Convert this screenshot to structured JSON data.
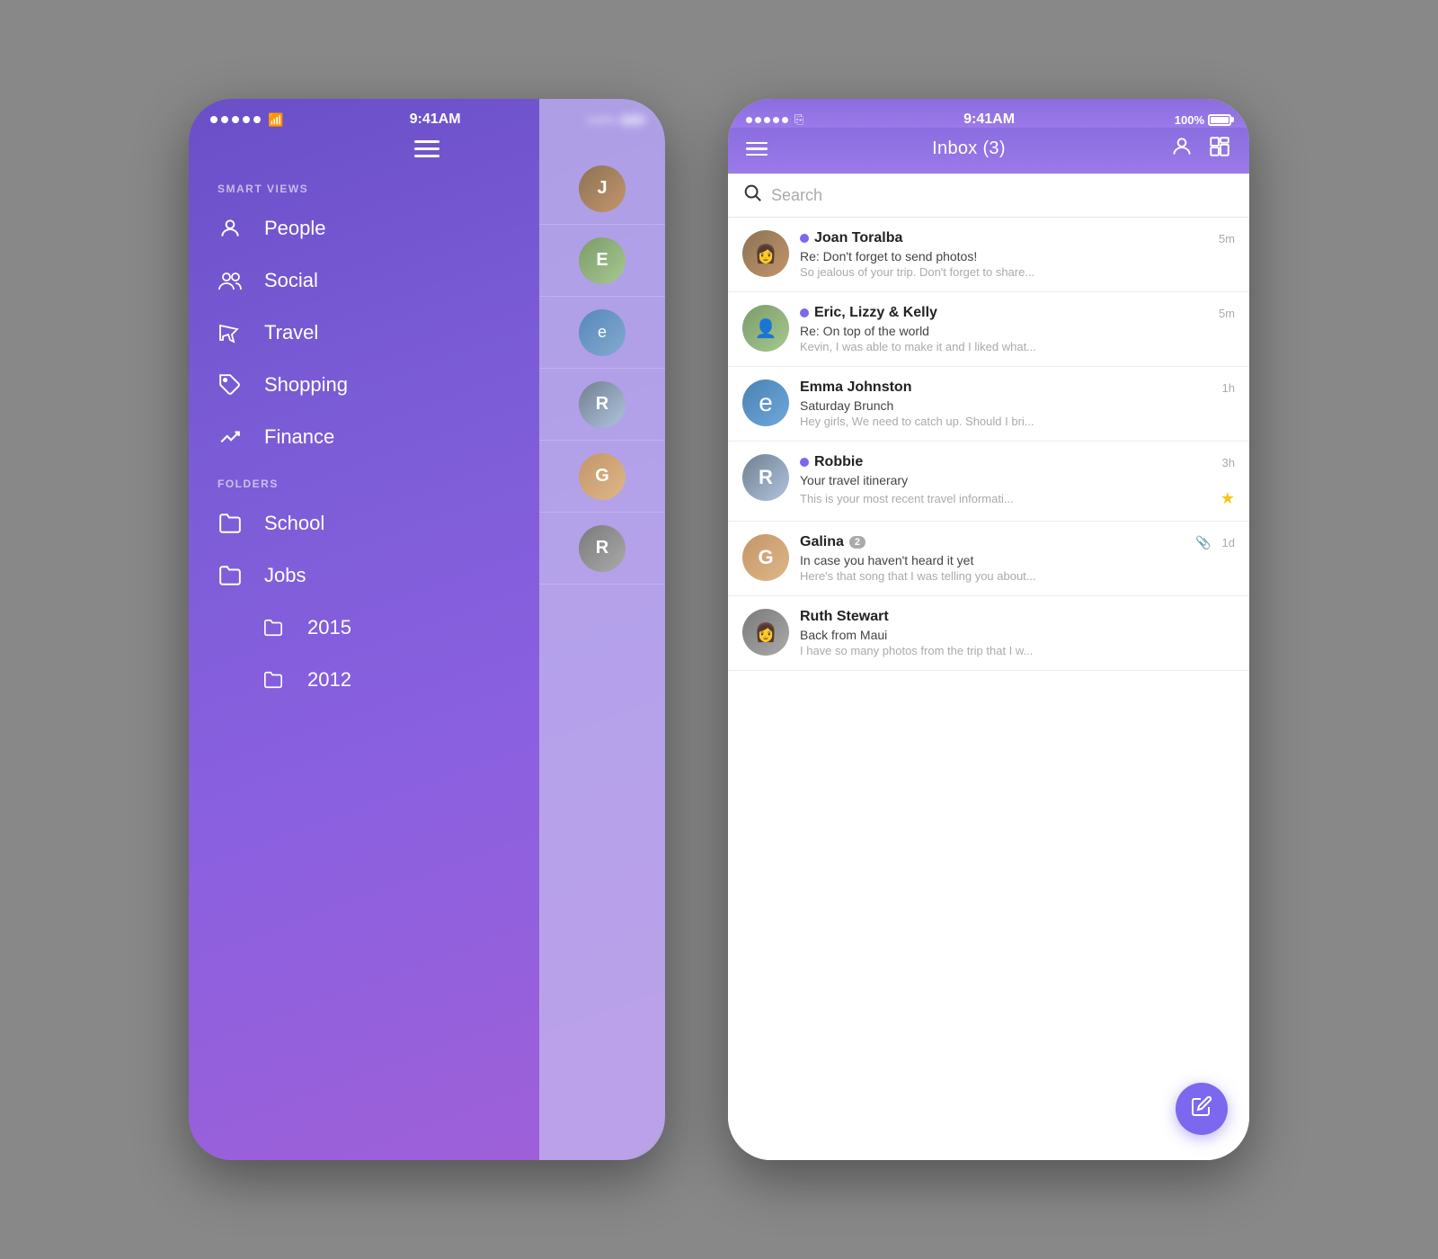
{
  "leftPhone": {
    "statusBar": {
      "dots": 5,
      "wifi": "wifi",
      "time": "9:41AM",
      "battery": "100%"
    },
    "hamburgerLabel": "menu",
    "sections": {
      "smartViews": {
        "label": "SMART VIEWS",
        "items": [
          {
            "id": "people",
            "icon": "person",
            "label": "People"
          },
          {
            "id": "social",
            "icon": "group",
            "label": "Social"
          },
          {
            "id": "travel",
            "icon": "plane",
            "label": "Travel"
          },
          {
            "id": "shopping",
            "icon": "tag",
            "label": "Shopping"
          },
          {
            "id": "finance",
            "icon": "chart",
            "label": "Finance"
          }
        ]
      },
      "folders": {
        "label": "FOLDERS",
        "items": [
          {
            "id": "school",
            "icon": "folder",
            "label": "School"
          },
          {
            "id": "jobs",
            "icon": "folder",
            "label": "Jobs"
          },
          {
            "id": "2015",
            "icon": "folder",
            "label": "2015"
          },
          {
            "id": "2012",
            "icon": "folder",
            "label": "2012"
          }
        ]
      }
    }
  },
  "rightPhone": {
    "statusBar": {
      "dots": 5,
      "wifi": "wifi",
      "time": "9:41AM",
      "battery": "100%"
    },
    "header": {
      "menuIcon": "menu",
      "title": "Inbox (3)",
      "profileIcon": "person",
      "layoutIcon": "grid"
    },
    "search": {
      "placeholder": "Search",
      "icon": "search"
    },
    "emails": [
      {
        "id": "joan",
        "unread": true,
        "sender": "Joan Toralba",
        "time": "5m",
        "subject": "Re: Don't forget to send photos!",
        "preview": "So jealous of your trip. Don't forget to share...",
        "avatarColor": "#8B7355",
        "avatarText": "J",
        "starred": false,
        "hasAttachment": false,
        "count": null
      },
      {
        "id": "eric",
        "unread": true,
        "sender": "Eric, Lizzy & Kelly",
        "time": "5m",
        "subject": "Re: On top of the world",
        "preview": "Kevin, I was able to make it and I liked what...",
        "avatarColor": "#7B9B6B",
        "avatarText": "E",
        "starred": false,
        "hasAttachment": false,
        "count": null
      },
      {
        "id": "emma",
        "unread": false,
        "sender": "Emma Johnston",
        "time": "1h",
        "subject": "Saturday Brunch",
        "preview": "Hey girls, We need to catch up. Should I bri...",
        "avatarColor": "#4A82B4",
        "avatarText": "e",
        "starred": false,
        "hasAttachment": false,
        "count": null
      },
      {
        "id": "robbie",
        "unread": true,
        "sender": "Robbie",
        "time": "3h",
        "subject": "Your travel itinerary",
        "preview": "This is your most recent travel informati...",
        "avatarColor": "#708090",
        "avatarText": "R",
        "starred": true,
        "hasAttachment": false,
        "count": null
      },
      {
        "id": "galina",
        "unread": false,
        "sender": "Galina",
        "time": "1d",
        "subject": "In case you haven't heard it yet",
        "preview": "Here's that song that I was telling you about...",
        "avatarColor": "#C4956A",
        "avatarText": "G",
        "starred": false,
        "hasAttachment": true,
        "count": 2
      },
      {
        "id": "ruth",
        "unread": false,
        "sender": "Ruth Stewart",
        "time": "",
        "subject": "Back from Maui",
        "preview": "I have so many photos from the trip that I w...",
        "avatarColor": "#7A7A7A",
        "avatarText": "R",
        "starred": false,
        "hasAttachment": false,
        "count": null
      }
    ],
    "composeButton": {
      "icon": "✏️",
      "label": "compose"
    }
  }
}
